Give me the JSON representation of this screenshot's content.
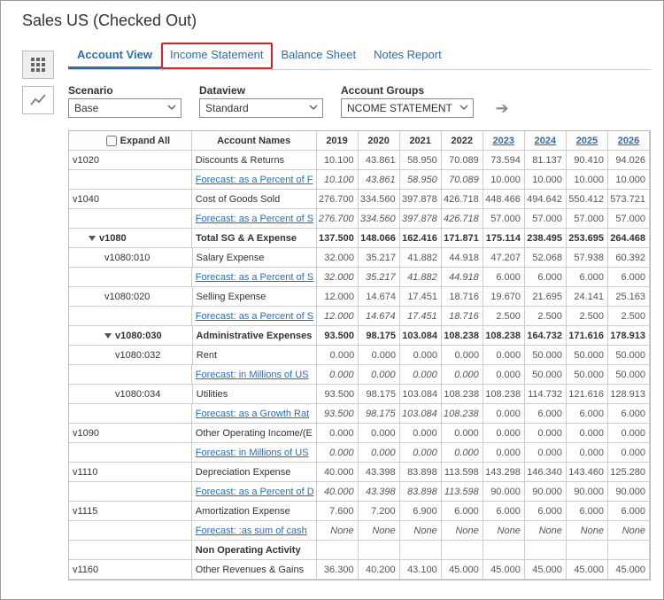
{
  "title": "Sales US (Checked Out)",
  "tabs": {
    "account_view": "Account View",
    "income_statement": "Income Statement",
    "balance_sheet": "Balance Sheet",
    "notes_report": "Notes Report"
  },
  "filters": {
    "scenario_label": "Scenario",
    "scenario_value": "Base",
    "dataview_label": "Dataview",
    "dataview_value": "Standard",
    "account_groups_label": "Account Groups",
    "account_groups_value": "NCOME STATEMENT"
  },
  "grid": {
    "expand_all": "Expand All",
    "col_account_names": "Account Names",
    "years": [
      "2019",
      "2020",
      "2021",
      "2022",
      "2023",
      "2024",
      "2025",
      "2026"
    ],
    "rows": [
      {
        "acct": "v1020",
        "name": "Discounts & Returns",
        "vals": [
          "10.100",
          "43.861",
          "58.950",
          "70.089",
          "73.594",
          "81.137",
          "90.410",
          "94.026"
        ]
      },
      {
        "acct": "",
        "name_link": "Forecast: as a Percent of F",
        "green": [
          "10.100",
          "43.861",
          "58.950",
          "70.089"
        ],
        "rest": [
          "10.000",
          "10.000",
          "10.000",
          "10.000"
        ]
      },
      {
        "acct": "v1040",
        "name": "Cost of Goods Sold",
        "vals": [
          "276.700",
          "334.560",
          "397.878",
          "426.718",
          "448.466",
          "494.642",
          "550.412",
          "573.721"
        ]
      },
      {
        "acct": "",
        "name_link": "Forecast: as a Percent of S",
        "green": [
          "276.700",
          "334.560",
          "397.878",
          "426.718"
        ],
        "rest": [
          "57.000",
          "57.000",
          "57.000",
          "57.000"
        ]
      },
      {
        "acct": "v1080",
        "bold": true,
        "tree": true,
        "indent": 1,
        "name": "Total SG & A Expense",
        "vals": [
          "137.500",
          "148.066",
          "162.416",
          "171.871",
          "175.114",
          "238.495",
          "253.695",
          "264.468"
        ]
      },
      {
        "acct": "v1080:010",
        "indent": 2,
        "name": "Salary Expense",
        "vals": [
          "32.000",
          "35.217",
          "41.882",
          "44.918",
          "47.207",
          "52.068",
          "57.938",
          "60.392"
        ]
      },
      {
        "acct": "",
        "name_link": "Forecast: as a Percent of S",
        "green": [
          "32.000",
          "35.217",
          "41.882",
          "44.918"
        ],
        "rest": [
          "6.000",
          "6.000",
          "6.000",
          "6.000"
        ]
      },
      {
        "acct": "v1080:020",
        "indent": 2,
        "name": "Selling Expense",
        "vals": [
          "12.000",
          "14.674",
          "17.451",
          "18.716",
          "19.670",
          "21.695",
          "24.141",
          "25.163"
        ]
      },
      {
        "acct": "",
        "name_link": "Forecast: as a Percent of S",
        "green": [
          "12.000",
          "14.674",
          "17.451",
          "18.716"
        ],
        "rest": [
          "2.500",
          "2.500",
          "2.500",
          "2.500"
        ]
      },
      {
        "acct": "v1080:030",
        "bold": true,
        "tree": true,
        "indent": 2,
        "name": "Administrative Expenses",
        "vals": [
          "93.500",
          "98.175",
          "103.084",
          "108.238",
          "108.238",
          "164.732",
          "171.616",
          "178.913"
        ]
      },
      {
        "acct": "v1080:032",
        "indent": 3,
        "name": "Rent",
        "vals": [
          "0.000",
          "0.000",
          "0.000",
          "0.000",
          "0.000",
          "50.000",
          "50.000",
          "50.000"
        ]
      },
      {
        "acct": "",
        "name_link": "Forecast: in Millions of US",
        "green": [
          "0.000",
          "0.000",
          "0.000",
          "0.000"
        ],
        "rest": [
          "0.000",
          "50.000",
          "50.000",
          "50.000"
        ]
      },
      {
        "acct": "v1080:034",
        "indent": 3,
        "name": "Utilities",
        "vals": [
          "93.500",
          "98.175",
          "103.084",
          "108.238",
          "108.238",
          "114.732",
          "121.616",
          "128.913"
        ]
      },
      {
        "acct": "",
        "name_link": "Forecast: as a Growth Rat",
        "green": [
          "93.500",
          "98.175",
          "103.084",
          "108.238"
        ],
        "rest": [
          "0.000",
          "6.000",
          "6.000",
          "6.000"
        ]
      },
      {
        "acct": "v1090",
        "name": "Other Operating Income/(E",
        "vals": [
          "0.000",
          "0.000",
          "0.000",
          "0.000",
          "0.000",
          "0.000",
          "0.000",
          "0.000"
        ]
      },
      {
        "acct": "",
        "name_link": "Forecast: in Millions of US",
        "green": [
          "0.000",
          "0.000",
          "0.000",
          "0.000"
        ],
        "rest": [
          "0.000",
          "0.000",
          "0.000",
          "0.000"
        ]
      },
      {
        "acct": "v1110",
        "name": "Depreciation Expense",
        "vals": [
          "40.000",
          "43.398",
          "83.898",
          "113.598",
          "143.298",
          "146.340",
          "143.460",
          "125.280"
        ]
      },
      {
        "acct": "",
        "name_link": "Forecast: as a Percent of D",
        "green": [
          "40.000",
          "43.398",
          "83.898",
          "113.598"
        ],
        "rest": [
          "90.000",
          "90.000",
          "90.000",
          "90.000"
        ]
      },
      {
        "acct": "v1115",
        "name": "Amortization Expense",
        "vals": [
          "7.600",
          "7.200",
          "6.900",
          "6.000",
          "6.000",
          "6.000",
          "6.000",
          "6.000"
        ]
      },
      {
        "acct": "",
        "name_link": "Forecast: :as sum of cash",
        "green_txt": [
          "None",
          "None",
          "None",
          "None"
        ],
        "rest_txt": [
          "None",
          "None",
          "None",
          "None"
        ]
      },
      {
        "acct": "",
        "bold": true,
        "name": "Non Operating Activity",
        "vals": [
          "",
          "",
          "",
          "",
          "",
          "",
          "",
          ""
        ]
      },
      {
        "acct": "v1160",
        "name": "Other Revenues & Gains",
        "vals": [
          "36.300",
          "40.200",
          "43.100",
          "45.000",
          "45.000",
          "45.000",
          "45.000",
          "45.000"
        ]
      }
    ]
  }
}
